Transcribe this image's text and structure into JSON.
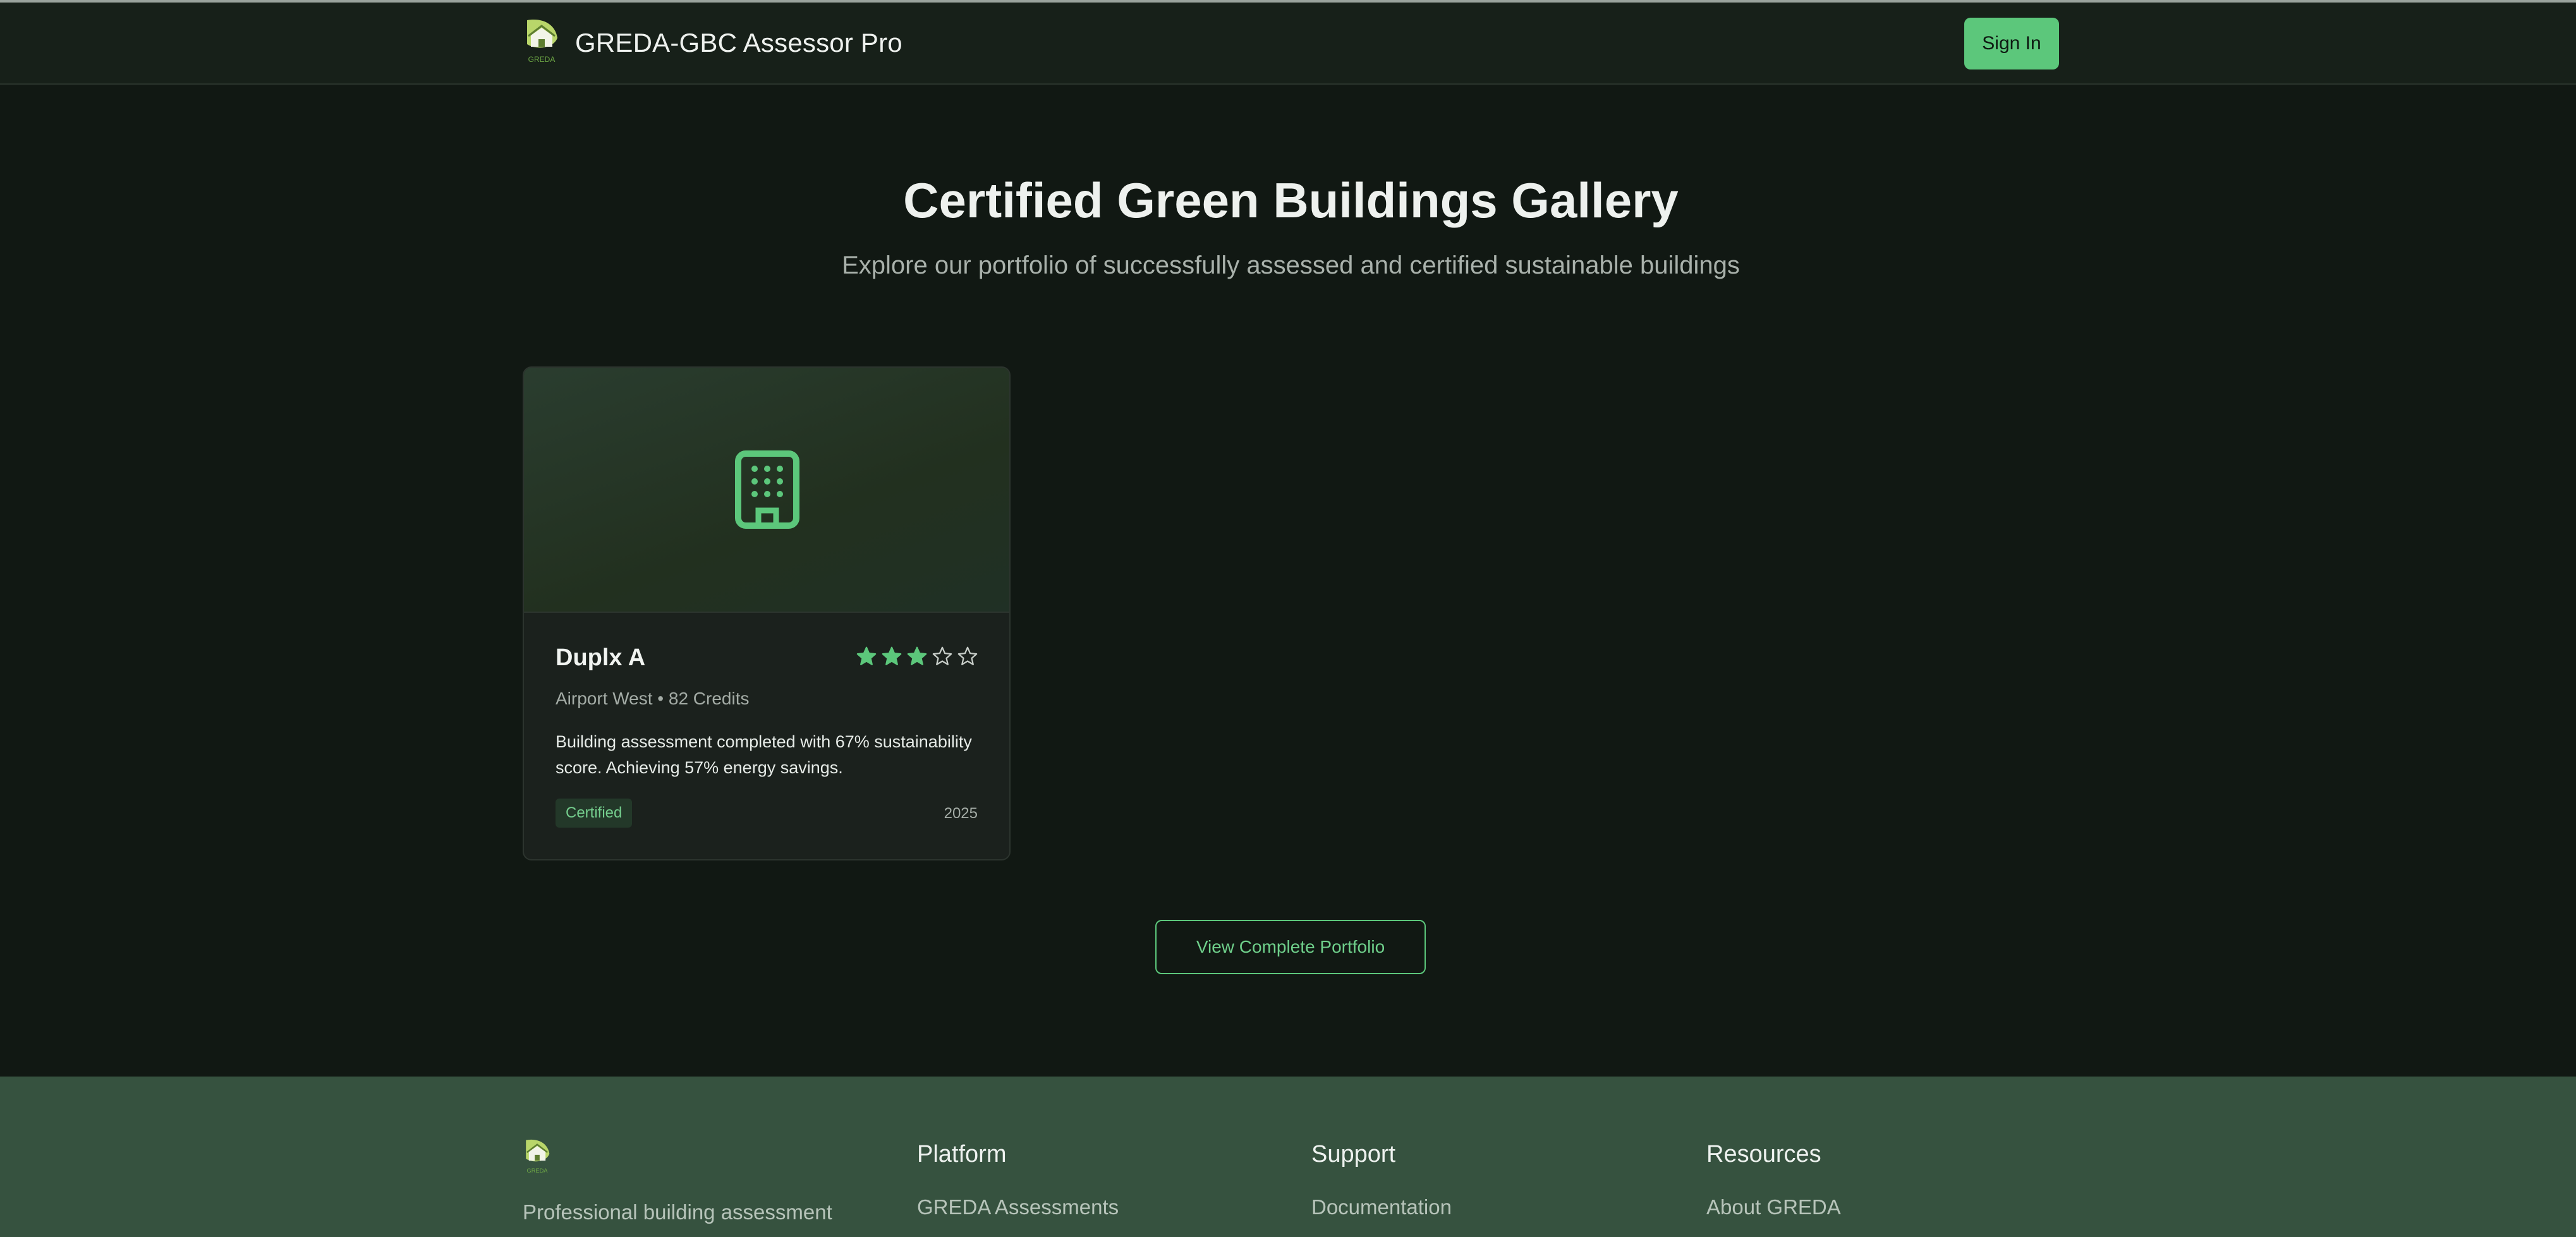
{
  "header": {
    "app_title": "GREDA-GBC Assessor Pro",
    "logo_text": "GREDA",
    "sign_in_label": "Sign In"
  },
  "hero": {
    "title": "Certified Green Buildings Gallery",
    "subtitle": "Explore our portfolio of successfully assessed and certified sustainable buildings"
  },
  "gallery": {
    "cards": [
      {
        "name": "Duplx A",
        "meta": "Airport West • 82 Credits",
        "description": "Building assessment completed with 67% sustainability score. Achieving 57% energy savings.",
        "badge": "Certified",
        "year": "2025",
        "rating": 3,
        "rating_max": 5,
        "icon": "building-icon"
      }
    ]
  },
  "portfolio_button_label": "View Complete Portfolio",
  "footer": {
    "tagline": "Professional building assessment",
    "columns": [
      {
        "heading": "Platform",
        "first_link": "GREDA Assessments"
      },
      {
        "heading": "Support",
        "first_link": "Documentation"
      },
      {
        "heading": "Resources",
        "first_link": "About GREDA"
      }
    ]
  },
  "colors": {
    "accent": "#5cc77b",
    "background": "#111813",
    "header_bg": "#172019",
    "footer_bg": "#36523f",
    "card_bg": "#1b211d"
  }
}
